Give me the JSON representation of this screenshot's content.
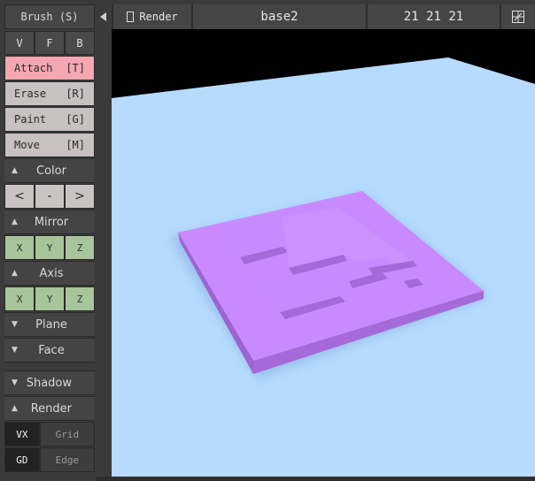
{
  "panel": {
    "brush_label": "Brush (S)",
    "views": [
      "V",
      "F",
      "B"
    ],
    "tools": [
      {
        "name": "Attach",
        "key": "[T]",
        "active": true
      },
      {
        "name": "Erase",
        "key": "[R]",
        "active": false
      },
      {
        "name": "Paint",
        "key": "[G]",
        "active": false
      },
      {
        "name": "Move",
        "key": "[M]",
        "active": false
      }
    ],
    "color_section": "Color",
    "color_buttons": [
      "<",
      "-",
      ">"
    ],
    "mirror_section": "Mirror",
    "mirror_axes": [
      "X",
      "Y",
      "Z"
    ],
    "axis_section": "Axis",
    "axis_axes": [
      "X",
      "Y",
      "Z"
    ],
    "plane_section": "Plane",
    "face_section": "Face",
    "shadow_section": "Shadow",
    "render_section": "Render",
    "toggles_row1": [
      "VX",
      "Grid"
    ],
    "toggles_row2": [
      "GD",
      "Edge"
    ]
  },
  "topbar": {
    "render_label": "Render",
    "model_name": "base2",
    "dimensions": "21 21 21"
  },
  "colors": {
    "viewport_bg": "#b6dbff",
    "voxel_top": "#c98aff",
    "voxel_side": "#a56ad8",
    "active_tool": "#f4a7b1",
    "axis_button": "#a8c49b"
  },
  "icons": {
    "collapse": "triangle-left-icon",
    "render_checkbox": "checkbox-icon",
    "layout": "layout-icon"
  }
}
